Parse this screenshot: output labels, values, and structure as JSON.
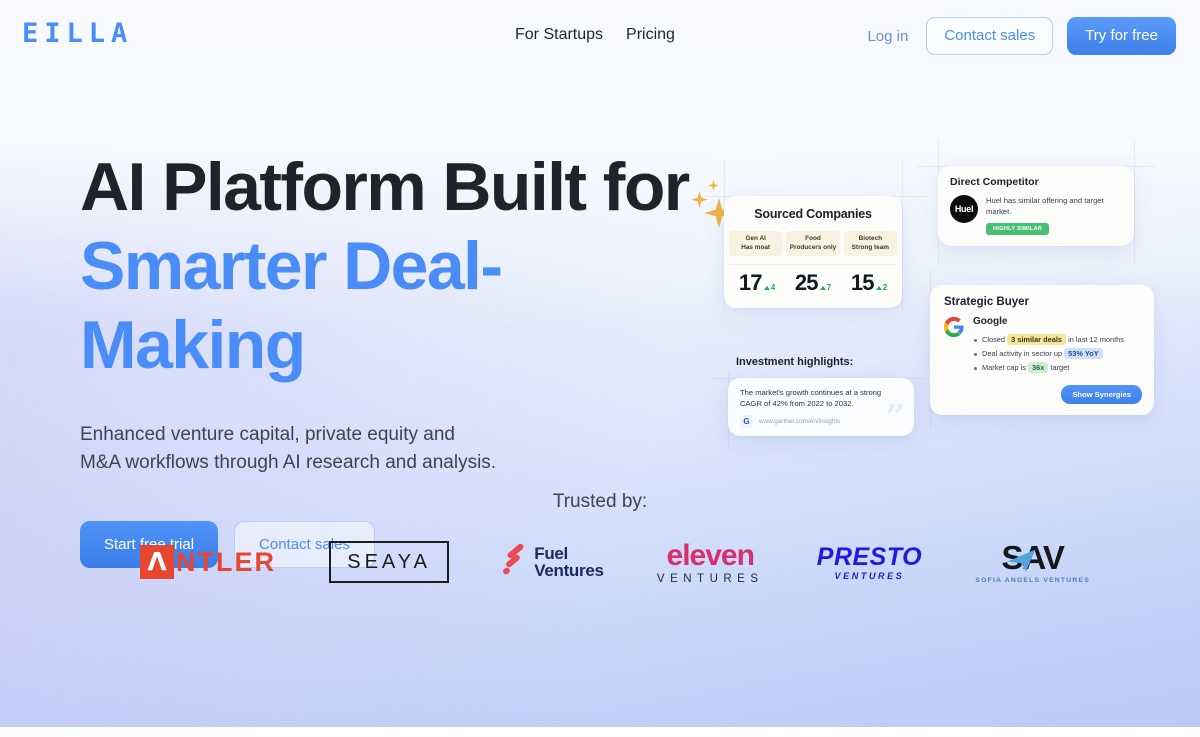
{
  "brand": {
    "logo_text": "EILLA",
    "accent_color": "#4b8df8"
  },
  "header": {
    "nav": [
      {
        "label": "For Startups"
      },
      {
        "label": "Pricing"
      }
    ],
    "login_label": "Log in",
    "contact_sales_label": "Contact sales",
    "try_free_label": "Try for free"
  },
  "hero": {
    "title_line1": "AI Platform Built for",
    "title_line2": "Smarter Deal-Making",
    "subtitle": "Enhanced venture capital, private equity and M&A workflows through AI research and analysis.",
    "cta_primary": "Start free trial",
    "cta_secondary": "Contact sales"
  },
  "cards": {
    "sourced": {
      "title": "Sourced Companies",
      "columns": [
        {
          "tag_line1": "Gen AI",
          "tag_line2": "Has moat",
          "value": "17",
          "delta": "4"
        },
        {
          "tag_line1": "Food",
          "tag_line2": "Producers only",
          "value": "25",
          "delta": "7"
        },
        {
          "tag_line1": "Biotech",
          "tag_line2": "Strong team",
          "value": "15",
          "delta": "2"
        }
      ]
    },
    "competitor": {
      "title": "Direct Competitor",
      "company": "Huel",
      "description": "Huel has similar offering and target market.",
      "badge": "HIGHLY SIMILAR",
      "badge_color": "#48c073"
    },
    "buyer": {
      "title": "Strategic Buyer",
      "company": "Google",
      "bullets": [
        {
          "pre": "Closed ",
          "highlight": "3 similar deals",
          "post": " in last 12 months",
          "highlight_style": "yellow"
        },
        {
          "pre": "Deal activity in sector up ",
          "highlight": "53% YoY",
          "post": "",
          "highlight_style": "blue"
        },
        {
          "pre": "Market cap is ",
          "highlight": "36x",
          "post": " target",
          "highlight_style": "green"
        }
      ],
      "button_label": "Show Synergies"
    },
    "insight": {
      "label": "Investment highlights:",
      "quote": "The market's growth continues at a strong CAGR of 42% from 2022 to 2032.",
      "source_initial": "G",
      "source_url": "www.gartner.com/en/insights"
    }
  },
  "trusted": {
    "label": "Trusted by:",
    "logos": [
      {
        "name": "antler",
        "text": "NTLER",
        "mark": "Λ"
      },
      {
        "name": "seaya",
        "text": "SEAYA"
      },
      {
        "name": "fuel",
        "line1": "Fuel",
        "line2": "Ventures"
      },
      {
        "name": "eleven",
        "line1": "eleven",
        "line2": "VENTURES"
      },
      {
        "name": "presto",
        "line1": "PRESTO",
        "line2": "VENTURES"
      },
      {
        "name": "sav",
        "line1": "SAV",
        "line2": "SOFIA ANGELS VENTURES"
      }
    ]
  }
}
